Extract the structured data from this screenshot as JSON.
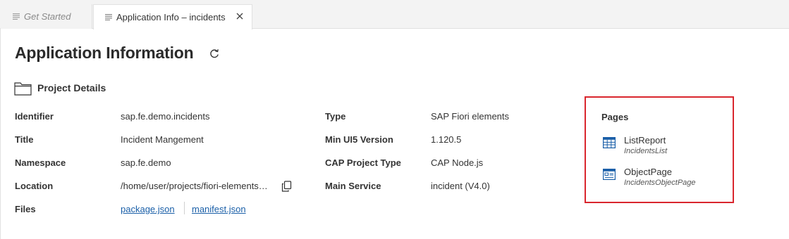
{
  "tabs": [
    {
      "label": "Get Started",
      "active": false
    },
    {
      "label": "Application Info – incidents",
      "active": true
    }
  ],
  "header": {
    "title": "Application Information"
  },
  "project_details": {
    "section_title": "Project Details",
    "left_rows": [
      {
        "label": "Identifier",
        "value": "sap.fe.demo.incidents"
      },
      {
        "label": "Title",
        "value": "Incident Mangement"
      },
      {
        "label": "Namespace",
        "value": "sap.fe.demo"
      },
      {
        "label": "Location",
        "value": "/home/user/projects/fiori-elements…"
      },
      {
        "label": "Files",
        "links": [
          "package.json",
          "manifest.json"
        ]
      }
    ],
    "right_rows": [
      {
        "label": "Type",
        "value": "SAP Fiori elements"
      },
      {
        "label": "Min UI5 Version",
        "value": "1.120.5"
      },
      {
        "label": "CAP Project Type",
        "value": "CAP Node.js"
      },
      {
        "label": "Main Service",
        "value": "incident (V4.0)"
      }
    ]
  },
  "pages": {
    "title": "Pages",
    "items": [
      {
        "name": "ListReport",
        "subtitle": "IncidentsList",
        "icon": "table-icon"
      },
      {
        "name": "ObjectPage",
        "subtitle": "IncidentsObjectPage",
        "icon": "object-page-icon"
      }
    ]
  },
  "colors": {
    "highlight_border": "#d9262e",
    "link": "#1a5fa8"
  }
}
